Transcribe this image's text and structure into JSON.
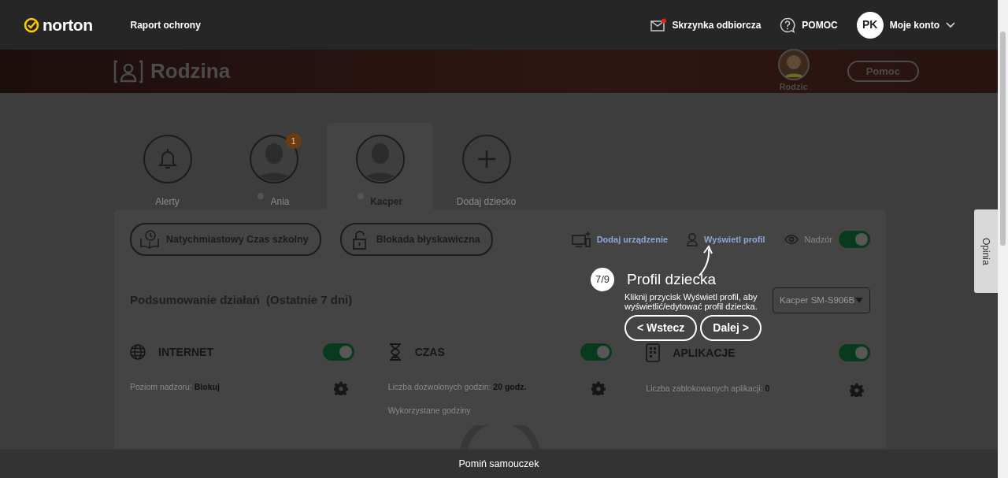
{
  "navbar": {
    "logo": "norton",
    "links": [
      {
        "label": "Raport ochrony"
      }
    ],
    "inbox": {
      "label": "Skrzynka odbiorcza",
      "unread": true
    },
    "help": {
      "label": "POMOC"
    },
    "account": {
      "initials": "PK",
      "label": "Moje konto"
    }
  },
  "header": {
    "title": "Rodzina",
    "parent": {
      "label": "Rodzic"
    },
    "help_button": "Pomoc"
  },
  "profiles": [
    {
      "kind": "alerts",
      "label": "Alerty",
      "selected": false
    },
    {
      "kind": "child",
      "label": "Ania",
      "badge": "1",
      "selected": false
    },
    {
      "kind": "child",
      "label": "Kacper",
      "selected": true
    },
    {
      "kind": "add",
      "label": "Dodaj dziecko",
      "selected": false
    }
  ],
  "actions": [
    {
      "kind": "school",
      "label": "Natychmiastowy Czas szkolny"
    },
    {
      "kind": "lock",
      "label": "Blokada błyskawiczna"
    }
  ],
  "links": [
    {
      "kind": "device",
      "label": "Dodaj urządzenie"
    },
    {
      "kind": "profile",
      "label": "Wyświetl profil"
    }
  ],
  "supervision": {
    "label": "Nadzór",
    "on": true
  },
  "summary": {
    "title": "Podsumowanie działań",
    "period": "(Ostatnie 7 dni)",
    "device": "Kacper SM-S906B"
  },
  "cards": [
    {
      "kind": "internet",
      "title": "INTERNET",
      "on": true,
      "lines": [
        "Poziom nadzoru: **Blokuj**"
      ]
    },
    {
      "kind": "time",
      "title": "CZAS",
      "on": true,
      "lines": [
        "Liczba dozwolonych godzin: **20 godz.**",
        "Wykorzystane godziny"
      ]
    },
    {
      "kind": "apps",
      "title": "APLIKACJE",
      "on": true,
      "lines": [
        "Liczba zablokowanych aplikacji: **0**"
      ]
    }
  ],
  "tour": {
    "step": "7/9",
    "title": "Profil dziecka",
    "text": "Kliknij przycisk Wyświetl profil, aby wyświetlić/edytować profil dziecka.",
    "buttons": [
      "< Wstecz",
      "Dalej >"
    ]
  },
  "feedback": "Opinia",
  "skip": "Pomiń samouczek"
}
